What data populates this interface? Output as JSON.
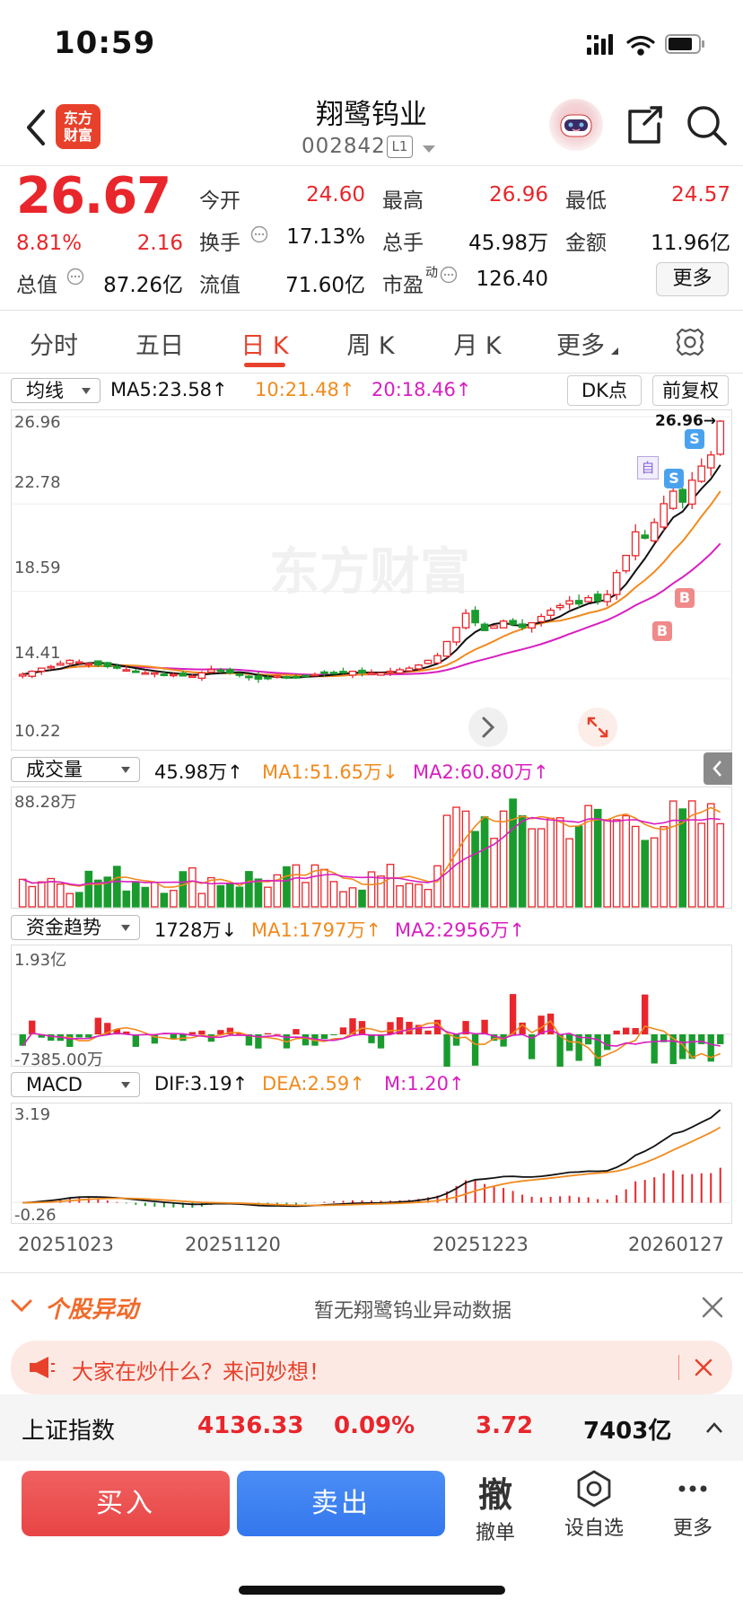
{
  "status": {
    "time": "10:59"
  },
  "header": {
    "logo_line1": "东方",
    "logo_line2": "财富",
    "name": "翔鹭钨业",
    "code": "002842",
    "level": "L1"
  },
  "quote": {
    "price": "26.67",
    "change_pct": "8.81%",
    "change": "2.16",
    "open_label": "今开",
    "open": "24.60",
    "high_label": "最高",
    "high": "26.96",
    "low_label": "最低",
    "low": "24.57",
    "turnover_label": "换手",
    "turnover": "17.13%",
    "volume_label": "总手",
    "volume": "45.98万",
    "amount_label": "金额",
    "amount": "11.96亿",
    "mktcap_label": "总值",
    "mktcap": "87.26亿",
    "float_label": "流值",
    "float": "71.60亿",
    "pe_label": "市盈",
    "pe_sup": "动",
    "pe": "126.40",
    "more": "更多"
  },
  "tabs": [
    "分时",
    "五日",
    "日 K",
    "周 K",
    "月 K",
    "更多"
  ],
  "ma_bar": {
    "selector": "均线",
    "ma5": "MA5:23.58↑",
    "ma10": "10:21.48↑",
    "ma20": "20:18.46↑",
    "dk": "DK点",
    "fq": "前复权"
  },
  "kline": {
    "watermark": "东方财富",
    "price_labels": [
      "26.96",
      "22.78",
      "18.59",
      "14.41",
      "10.22"
    ],
    "high_marker": "26.96→",
    "markers": {
      "self": "自",
      "s": "S",
      "b": "B"
    }
  },
  "volume": {
    "selector": "成交量",
    "val": "45.98万↑",
    "ma1": "MA1:51.65万↓",
    "ma2": "MA2:60.80万↑",
    "top": "88.28万"
  },
  "capital": {
    "selector": "资金趋势",
    "val": "1728万↓",
    "ma1": "MA1:1797万↑",
    "ma2": "MA2:2956万↑",
    "top": "1.93亿",
    "bottom": "-7385.00万"
  },
  "macd": {
    "selector": "MACD",
    "dif": "DIF:3.19↑",
    "dea": "DEA:2.59↑",
    "m": "M:1.20↑",
    "top": "3.19",
    "bottom": "-0.26"
  },
  "dates": [
    "20251023",
    "20251120",
    "20251223",
    "20260127"
  ],
  "alert": {
    "title": "个股异动",
    "text": "暂无翔鹭钨业异动数据"
  },
  "chat": {
    "text": "大家在炒什么？来问妙想！"
  },
  "index": {
    "name": "上证指数",
    "value": "4136.33",
    "pct": "0.09%",
    "change": "3.72",
    "amount": "7403亿"
  },
  "trade": {
    "buy": "买入",
    "sell": "卖出",
    "cancel_glyph": "撤",
    "cancel": "撤单",
    "watch": "设自选",
    "more": "更多"
  },
  "chart_data": {
    "type": "candlestick",
    "price_axis": {
      "labels": [
        26.96,
        22.78,
        18.59,
        14.41,
        10.22
      ],
      "ylim": [
        10.22,
        26.96
      ]
    },
    "date_labels": [
      "20251023",
      "20251120",
      "20251223",
      "20260127"
    ],
    "closes": [
      10.5,
      10.7,
      10.9,
      11.0,
      11.2,
      11.4,
      11.3,
      11.2,
      11.1,
      11.0,
      10.9,
      10.8,
      10.7,
      10.6,
      10.6,
      10.5,
      10.5,
      10.4,
      10.4,
      10.6,
      10.8,
      10.7,
      10.6,
      10.5,
      10.3,
      10.2,
      10.3,
      10.4,
      10.3,
      10.3,
      10.4,
      10.5,
      10.6,
      10.6,
      10.6,
      10.7,
      10.6,
      10.6,
      10.6,
      10.7,
      10.8,
      10.9,
      11.1,
      11.4,
      11.7,
      12.6,
      13.5,
      14.4,
      13.8,
      13.3,
      13.6,
      13.9,
      13.7,
      13.5,
      13.8,
      14.2,
      14.6,
      14.9,
      15.2,
      15.0,
      15.4,
      15.2,
      15.6,
      17.0,
      18.1,
      19.6,
      19.2,
      20.2,
      21.4,
      22.2,
      21.5,
      22.9,
      23.8,
      24.51,
      26.67
    ],
    "last_close": 26.67,
    "ma5_last": 23.58,
    "ma10_last": 21.48,
    "ma20_last": 18.46,
    "volume": {
      "top": "88.28万",
      "last": "45.98万",
      "ma1": "51.65万",
      "ma2": "60.80万"
    },
    "capital_trend": {
      "top": "1.93亿",
      "bottom": "-7385.00万",
      "last": "1728万"
    },
    "macd": {
      "dif": 3.19,
      "dea": 2.59,
      "m": 1.2,
      "ylim": [
        -0.26,
        3.19
      ]
    }
  }
}
